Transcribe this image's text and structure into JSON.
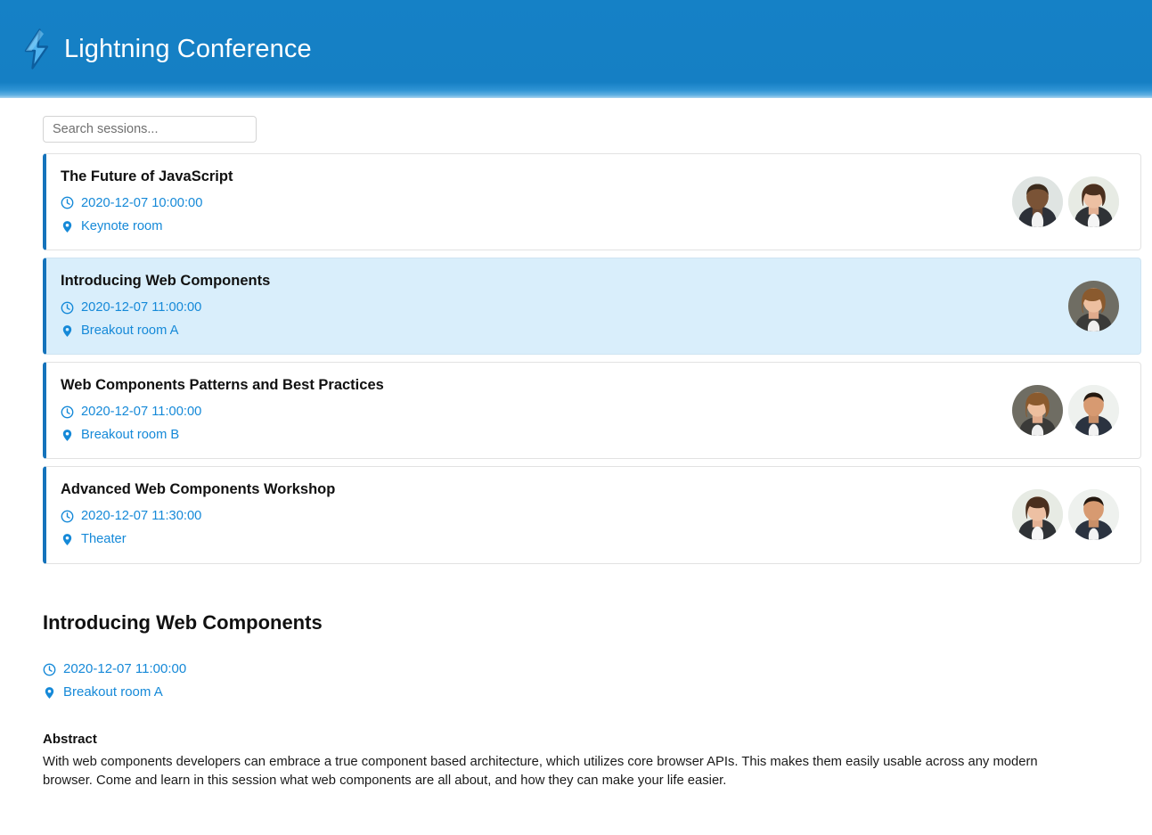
{
  "header": {
    "title": "Lightning Conference",
    "logo_icon": "lightning-bolt-icon",
    "background_color": "#1581c6"
  },
  "search": {
    "value": "",
    "placeholder": "Search sessions...",
    "icon": "search-input"
  },
  "icons": {
    "clock": "clock-icon",
    "location": "map-pin-icon"
  },
  "colors": {
    "accent": "#1589d8",
    "card_border_left": "#1573bb",
    "selected_background": "#d9eefb",
    "header": "#1581c6",
    "title_text": "#111111"
  },
  "sessions": [
    {
      "title": "The Future of JavaScript",
      "datetime": "2020-12-07 10:00:00",
      "location": "Keynote room",
      "selected": false,
      "speakers": [
        "speaker-avatar-1",
        "speaker-avatar-2"
      ]
    },
    {
      "title": "Introducing Web Components",
      "datetime": "2020-12-07 11:00:00",
      "location": "Breakout room A",
      "selected": true,
      "speakers": [
        "speaker-avatar-3"
      ]
    },
    {
      "title": "Web Components Patterns and Best Practices",
      "datetime": "2020-12-07 11:00:00",
      "location": "Breakout room B",
      "selected": false,
      "speakers": [
        "speaker-avatar-3",
        "speaker-avatar-4"
      ]
    },
    {
      "title": "Advanced Web Components Workshop",
      "datetime": "2020-12-07 11:30:00",
      "location": "Theater",
      "selected": false,
      "speakers": [
        "speaker-avatar-2",
        "speaker-avatar-4"
      ]
    }
  ],
  "detail": {
    "title": "Introducing Web Components",
    "datetime": "2020-12-07 11:00:00",
    "location": "Breakout room A",
    "abstract_heading": "Abstract",
    "abstract_body": "With web components developers can embrace a true component based architecture, which utilizes core browser APIs. This makes them easily usable across any modern browser. Come and learn in this session what web components are all about, and how they can make your life easier."
  }
}
